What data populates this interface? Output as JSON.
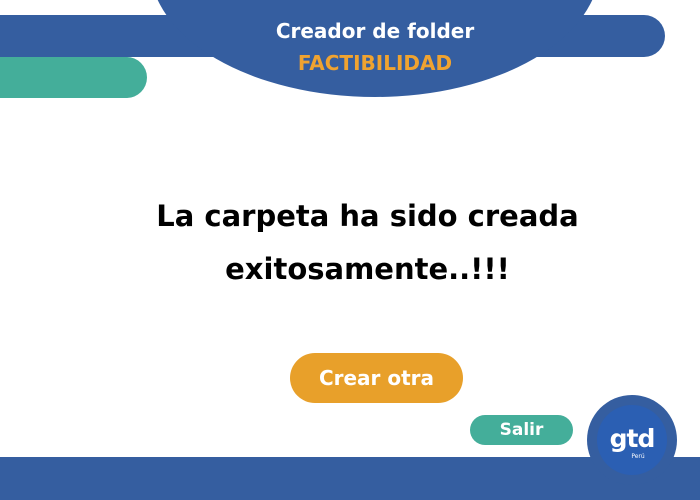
{
  "header": {
    "title": "Creador de folder",
    "subtitle": "FACTIBILIDAD"
  },
  "message": {
    "line1": "La carpeta ha sido creada",
    "line2": "exitosamente..!!!"
  },
  "buttons": {
    "create_another": "Crear otra",
    "exit": "Salir"
  },
  "logo": {
    "text": "gtd",
    "subtext": "Perú"
  },
  "colors": {
    "primary_blue": "#355ea0",
    "teal": "#44ae9a",
    "orange": "#e8a02a",
    "logo_blue": "#2b5fb3"
  }
}
